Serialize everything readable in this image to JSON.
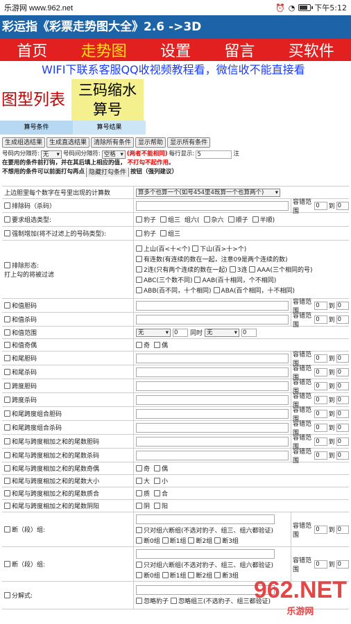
{
  "status": {
    "left": "乐游网 www.962.net",
    "time": "下午5:12"
  },
  "appbar": {
    "title": "彩运指《彩票走势图大全》2.6 ->3D"
  },
  "nav": {
    "items": [
      "首页",
      "走势图",
      "设置",
      "留言",
      "买软件"
    ]
  },
  "marquee": "WIFI下联系客服QQ收视频教程看，微信收不能直接看",
  "tab2": {
    "list": "图型列表",
    "three1": "三码缩水",
    "three2": "算号"
  },
  "tab3": {
    "a": "算号条件",
    "b": "算号结果"
  },
  "buttons": [
    "生成组选结果",
    "生成直选结果",
    "清除所有条件",
    "显示帮助",
    "显示所有条件"
  ],
  "settings": {
    "sep_label": "号码内分隔符:",
    "sep_val": "无",
    "sep2_label": "号码间分隔符:",
    "sep2_val": "空格",
    "warn": "(两者不能相同)",
    "perline": "每行显示:",
    "perline_val": "5",
    "note": "注",
    "line2a": "在要用的条件前打钩，并在其后填上相应的值，",
    "line2b": "不打勾不起作用。",
    "line3a": "不想用的条件可以前面打勾再点",
    "line3btn": "隐藏打勾条件",
    "line3b": "按钮（强列建议）"
  },
  "grid": {
    "first_label": "上边胆里每个数字在号里出现的计算数",
    "first_select": "算多个也算一个(如号454里4既算一个也算两个)",
    "tol": "容错范围",
    "zero": "0",
    "to": "到",
    "r_exclude": "排除码（杀码）",
    "r_type": "要求组选类型:",
    "t_opts": [
      "豹子",
      "组三",
      "组六(",
      "杂六",
      "顺子",
      "半顺)"
    ],
    "r_force": "强制增加(将不过滤上的号码类型):",
    "f_opts": [
      "豹子",
      "组三"
    ],
    "r_form1": "排除形态:",
    "r_form2": "打上勾的将被过滤",
    "form_opts": [
      "上山(百<十<个)",
      "下山(百>十>个)",
      "有连数(有连续的数在一起，注意09是两个连续的数)",
      "2连(只有两个连续的数在一起)",
      "3连",
      "AAA(三个相同的号)",
      "ABC(三个数不同)",
      "AAB(百十相同，个不相同)",
      "ABB(百不同，十个相同)",
      "ABA(百个相同，十不相同)"
    ],
    "rows": [
      "和值胆码",
      "和值杀码",
      "和值范围",
      "和值奇偶",
      "和尾胆码",
      "和尾杀码",
      "跨度胆码",
      "跨度杀码",
      "和尾跨度组合胆码",
      "和尾跨度组合杀码",
      "和尾与跨度相加之和的尾数胆码",
      "和尾与跨度相加之和的尾数杀码",
      "和尾与跨度相加之和的尾数奇偶",
      "和尾与跨度相加之和的尾数大小",
      "和尾与跨度相加之和的尾数质合",
      "和尾与跨度相加之和的尾数阴阳",
      "断（段）组:",
      "断（段）组:",
      "分解式:"
    ],
    "range_none": "无",
    "same_time": "同时",
    "odd": "奇",
    "even": "偶",
    "big": "大",
    "small": "小",
    "prime": "质",
    "comp": "合",
    "yin": "阴",
    "yang": "阳",
    "dz_opt": "只对组六断组(不选对豹子、组三、组六都验证)",
    "dz_groups": [
      "断0组",
      "断1组",
      "断2组",
      "断3组"
    ],
    "fj_opts": [
      "忽略豹子",
      "忽略组三(不选豹子、组三都验证)"
    ]
  },
  "watermark": {
    "big": "962.NET",
    "small": "乐游网"
  }
}
